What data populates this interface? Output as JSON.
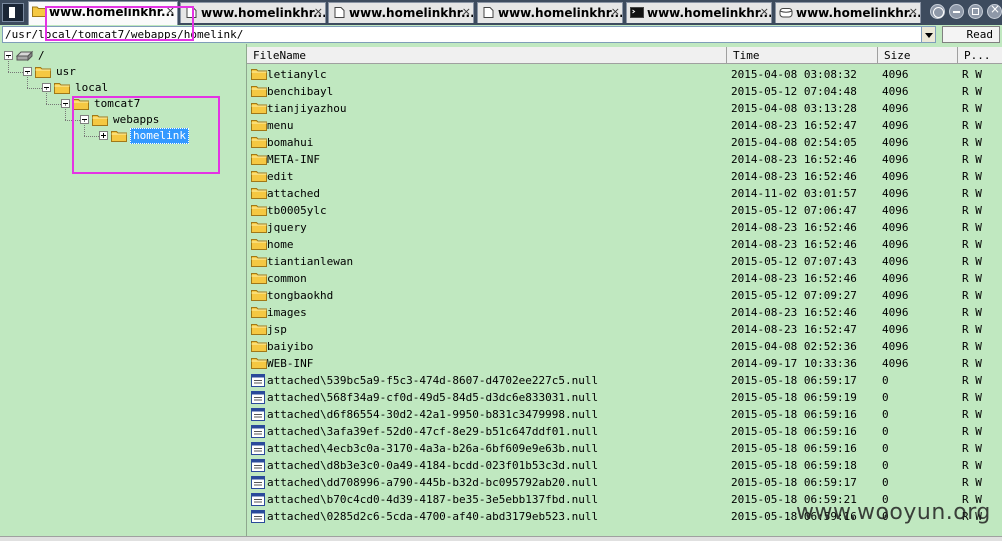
{
  "tabs": [
    {
      "title": "www.homelinkhr...",
      "icon": "folder-icon",
      "active": true
    },
    {
      "title": "www.homelinkhr...",
      "icon": "document-icon",
      "active": false
    },
    {
      "title": "www.homelinkhr...",
      "icon": "document-icon",
      "active": false
    },
    {
      "title": "www.homelinkhr...",
      "icon": "document-icon",
      "active": false
    },
    {
      "title": "www.homelinkhr...",
      "icon": "terminal-icon",
      "active": false
    },
    {
      "title": "www.homelinkhr...",
      "icon": "database-icon",
      "active": false
    }
  ],
  "tab_close_glyph": "×",
  "path": {
    "value": "/usr/local/tomcat7/webapps/homelink/"
  },
  "read_button": "Read",
  "tree": [
    {
      "label": "/",
      "level": 0,
      "icon": "drive-icon",
      "expander": "minus"
    },
    {
      "label": "usr",
      "level": 1,
      "icon": "folder-icon",
      "expander": "minus"
    },
    {
      "label": "local",
      "level": 2,
      "icon": "folder-icon",
      "expander": "minus"
    },
    {
      "label": "tomcat7",
      "level": 3,
      "icon": "folder-icon",
      "expander": "minus"
    },
    {
      "label": "webapps",
      "level": 4,
      "icon": "folder-icon",
      "expander": "minus"
    },
    {
      "label": "homelink",
      "level": 5,
      "icon": "folder-icon",
      "expander": "plus",
      "selected": true
    }
  ],
  "columns": {
    "name": "FileName",
    "time": "Time",
    "size": "Size",
    "perm": "P..."
  },
  "files": [
    {
      "name": "letianylc",
      "time": "2015-04-08 03:08:32",
      "size": "4096",
      "perm": "R W",
      "type": "folder"
    },
    {
      "name": "benchibayl",
      "time": "2015-05-12 07:04:48",
      "size": "4096",
      "perm": "R W",
      "type": "folder"
    },
    {
      "name": "tianjiyazhou",
      "time": "2015-04-08 03:13:28",
      "size": "4096",
      "perm": "R W",
      "type": "folder"
    },
    {
      "name": "menu",
      "time": "2014-08-23 16:52:47",
      "size": "4096",
      "perm": "R W",
      "type": "folder"
    },
    {
      "name": "bomahui",
      "time": "2015-04-08 02:54:05",
      "size": "4096",
      "perm": "R W",
      "type": "folder"
    },
    {
      "name": "META-INF",
      "time": "2014-08-23 16:52:46",
      "size": "4096",
      "perm": "R W",
      "type": "folder"
    },
    {
      "name": "edit",
      "time": "2014-08-23 16:52:46",
      "size": "4096",
      "perm": "R W",
      "type": "folder"
    },
    {
      "name": "attached",
      "time": "2014-11-02 03:01:57",
      "size": "4096",
      "perm": "R W",
      "type": "folder"
    },
    {
      "name": "tb0005ylc",
      "time": "2015-05-12 07:06:47",
      "size": "4096",
      "perm": "R W",
      "type": "folder"
    },
    {
      "name": "jquery",
      "time": "2014-08-23 16:52:46",
      "size": "4096",
      "perm": "R W",
      "type": "folder"
    },
    {
      "name": "home",
      "time": "2014-08-23 16:52:46",
      "size": "4096",
      "perm": "R W",
      "type": "folder"
    },
    {
      "name": "tiantianlewan",
      "time": "2015-05-12 07:07:43",
      "size": "4096",
      "perm": "R W",
      "type": "folder"
    },
    {
      "name": "common",
      "time": "2014-08-23 16:52:46",
      "size": "4096",
      "perm": "R W",
      "type": "folder"
    },
    {
      "name": "tongbaokhd",
      "time": "2015-05-12 07:09:27",
      "size": "4096",
      "perm": "R W",
      "type": "folder"
    },
    {
      "name": "images",
      "time": "2014-08-23 16:52:46",
      "size": "4096",
      "perm": "R W",
      "type": "folder"
    },
    {
      "name": "jsp",
      "time": "2014-08-23 16:52:47",
      "size": "4096",
      "perm": "R W",
      "type": "folder"
    },
    {
      "name": "baiyibo",
      "time": "2015-04-08 02:52:36",
      "size": "4096",
      "perm": "R W",
      "type": "folder"
    },
    {
      "name": "WEB-INF",
      "time": "2014-09-17 10:33:36",
      "size": "4096",
      "perm": "R W",
      "type": "folder"
    },
    {
      "name": "attached\\539bc5a9-f5c3-474d-8607-d4702ee227c5.null",
      "time": "2015-05-18 06:59:17",
      "size": "0",
      "perm": "R W",
      "type": "file"
    },
    {
      "name": "attached\\568f34a9-cf0d-49d5-84d5-d3dc6e833031.null",
      "time": "2015-05-18 06:59:19",
      "size": "0",
      "perm": "R W",
      "type": "file"
    },
    {
      "name": "attached\\d6f86554-30d2-42a1-9950-b831c3479998.null",
      "time": "2015-05-18 06:59:16",
      "size": "0",
      "perm": "R W",
      "type": "file"
    },
    {
      "name": "attached\\3afa39ef-52d0-47cf-8e29-b51c647ddf01.null",
      "time": "2015-05-18 06:59:16",
      "size": "0",
      "perm": "R W",
      "type": "file"
    },
    {
      "name": "attached\\4ecb3c0a-3170-4a3a-b26a-6bf609e9e63b.null",
      "time": "2015-05-18 06:59:16",
      "size": "0",
      "perm": "R W",
      "type": "file"
    },
    {
      "name": "attached\\d8b3e3c0-0a49-4184-bcdd-023f01b53c3d.null",
      "time": "2015-05-18 06:59:18",
      "size": "0",
      "perm": "R W",
      "type": "file"
    },
    {
      "name": "attached\\dd708996-a790-445b-b32d-bc095792ab20.null",
      "time": "2015-05-18 06:59:17",
      "size": "0",
      "perm": "R W",
      "type": "file"
    },
    {
      "name": "attached\\b70c4cd0-4d39-4187-be35-3e5ebb137fbd.null",
      "time": "2015-05-18 06:59:21",
      "size": "0",
      "perm": "R W",
      "type": "file"
    },
    {
      "name": "attached\\0285d2c6-5cda-4700-af40-abd3179eb523.null",
      "time": "2015-05-18 06:59:16",
      "size": "0",
      "perm": "R W",
      "type": "file"
    }
  ],
  "watermark": "www.wooyun.org",
  "colors": {
    "background": "#c0e8c0",
    "highlight": "#e433e4",
    "selection": "#3399ff",
    "folder": "#f5c842"
  }
}
